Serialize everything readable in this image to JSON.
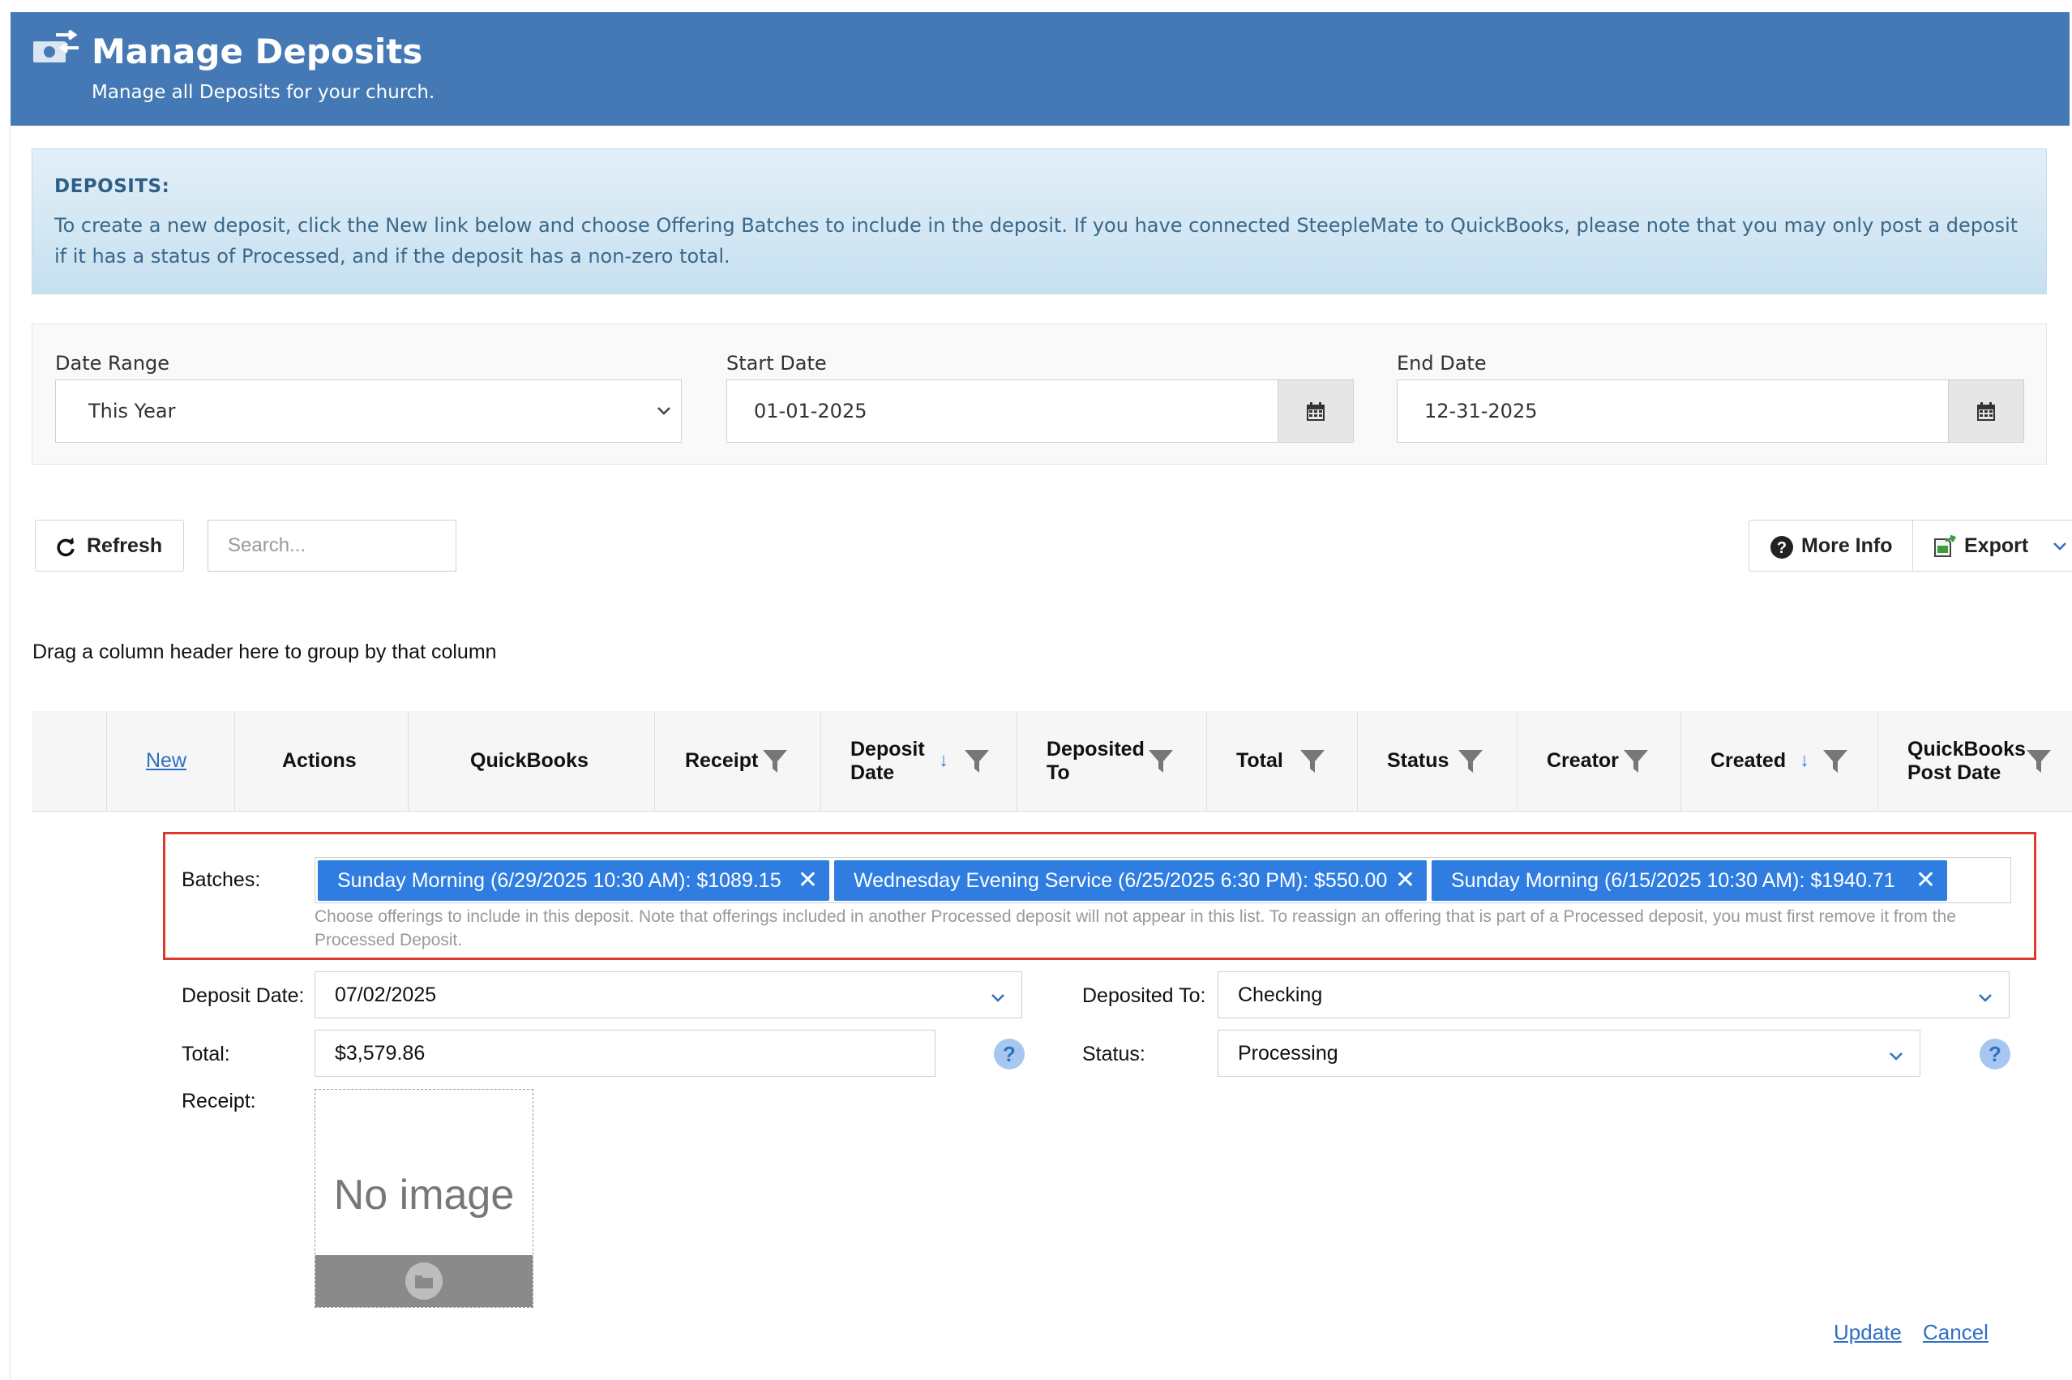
{
  "header": {
    "title": "Manage Deposits",
    "subtitle": "Manage all Deposits for your church.",
    "icon": "money-transfer-icon"
  },
  "info": {
    "title": "DEPOSITS:",
    "text": "To create a new deposit, click the New link below and choose Offering Batches to include in the deposit. If you have connected SteepleMate to QuickBooks, please note that you may only post a deposit if it has a status of Processed, and if the deposit has a non-zero total."
  },
  "filters": {
    "date_range_label": "Date Range",
    "date_range_value": "This Year",
    "start_label": "Start Date",
    "start_value": "01-01-2025",
    "end_label": "End Date",
    "end_value": "12-31-2025"
  },
  "toolbar": {
    "refresh": "Refresh",
    "search_placeholder": "Search...",
    "more_info": "More Info",
    "export": "Export"
  },
  "group_hint": "Drag a column header here to group by that column",
  "grid": {
    "new_link": "New",
    "columns": {
      "actions": "Actions",
      "quickbooks": "QuickBooks",
      "receipt": "Receipt",
      "deposit_date_1": "Deposit",
      "deposit_date_2": "Date",
      "deposited_to_1": "Deposited",
      "deposited_to_2": "To",
      "total": "Total",
      "status": "Status",
      "creator": "Creator",
      "created": "Created",
      "qb_post_1": "QuickBooks",
      "qb_post_2": "Post Date"
    }
  },
  "form": {
    "batches_label": "Batches:",
    "batches": [
      "Sunday Morning (6/29/2025 10:30 AM): $1089.15",
      "Wednesday Evening Service (6/25/2025 6:30 PM): $550.00",
      "Sunday Morning (6/15/2025 10:30 AM): $1940.71"
    ],
    "batches_hint": "Choose offerings to include in this deposit. Note that offerings included in another Processed deposit will not appear in this list. To reassign an offering that is part of a Processed deposit, you must first remove it from the Processed Deposit.",
    "deposit_date_label": "Deposit Date:",
    "deposit_date_value": "07/02/2025",
    "deposited_to_label": "Deposited To:",
    "deposited_to_value": "Checking",
    "total_label": "Total:",
    "total_value": "$3,579.86",
    "status_label": "Status:",
    "status_value": "Processing",
    "receipt_label": "Receipt:",
    "receipt_placeholder": "No image",
    "help_glyph": "?",
    "remove_glyph": "✕",
    "update": "Update",
    "cancel": "Cancel"
  },
  "colors": {
    "header_bg": "#4579b5",
    "tag_bg": "#2f7de1",
    "highlight_border": "#e0392b",
    "link": "#2f6fc2"
  }
}
